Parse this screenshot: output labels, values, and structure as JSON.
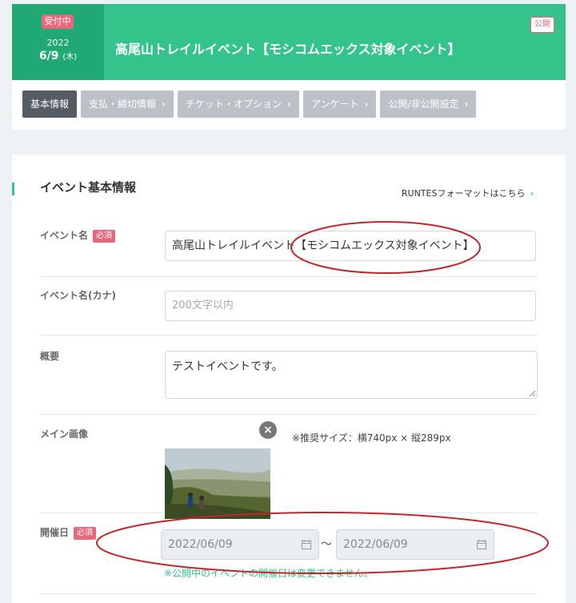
{
  "header": {
    "status": "受付中",
    "year": "2022",
    "day": "6/9",
    "weekday": "(木)",
    "title": "高尾山トレイルイベント【モシコムエックス対象イベント】",
    "visibility_badge": "公開"
  },
  "tabs": [
    {
      "label": "基本情報",
      "active": true
    },
    {
      "label": "支払・締切情報",
      "active": false
    },
    {
      "label": "チケット・オプション",
      "active": false
    },
    {
      "label": "アンケート",
      "active": false
    },
    {
      "label": "公開/非公開設定",
      "active": false
    }
  ],
  "form": {
    "section_title": "イベント基本情報",
    "format_link": "RUNTESフォーマットはこちら",
    "required_label": "必須",
    "event_name": {
      "label": "イベント名",
      "value": "高尾山トレイルイベント【モシコムエックス対象イベント】"
    },
    "event_name_kana": {
      "label": "イベント名(カナ)",
      "placeholder": "200文字以内"
    },
    "summary": {
      "label": "概要",
      "value": "テストイベントです。"
    },
    "main_image": {
      "label": "メイン画像",
      "size_note": "※推奨サイズ：横740px × 縦289px"
    },
    "event_date": {
      "label": "開催日",
      "start": "2022/06/09",
      "separator": "〜",
      "end": "2022/06/09",
      "note": "※公開中のイベントの開催日は変更できません。"
    }
  },
  "colors": {
    "brand_green": "#34c48b",
    "dark_green": "#20a875",
    "required_pink": "#e9677c",
    "annotation_red": "#c0272d"
  }
}
